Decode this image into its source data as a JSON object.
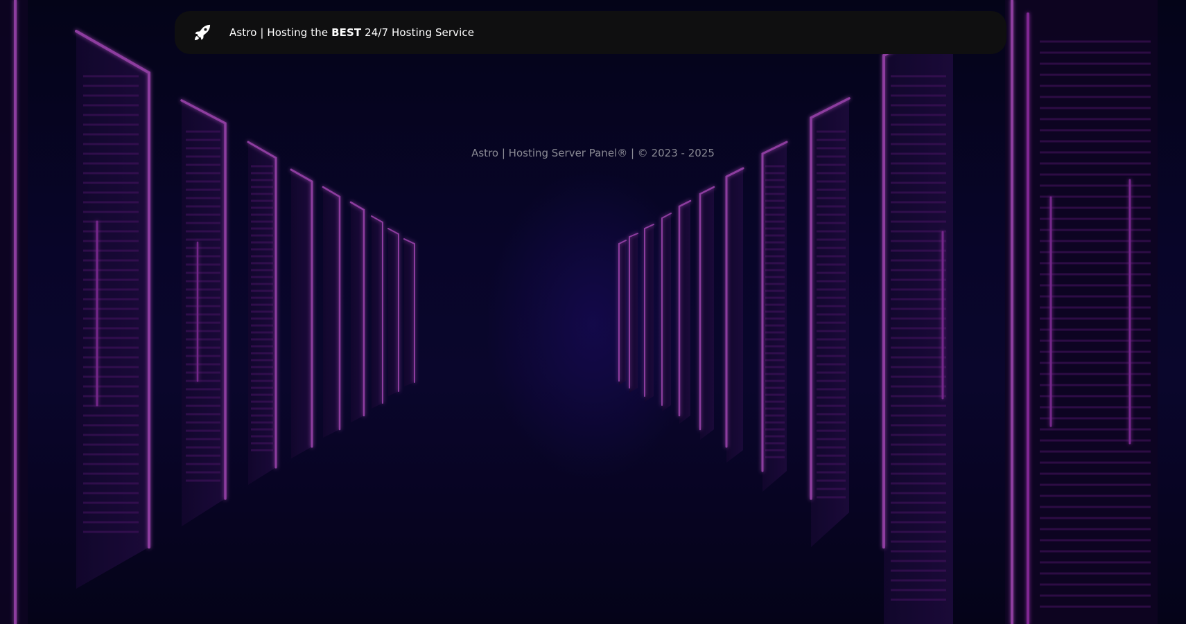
{
  "navbar": {
    "icon": "rocket-icon",
    "brand_prefix": "Astro | Hosting the ",
    "brand_emphasis": "BEST",
    "brand_suffix": " 24/7 Hosting Service"
  },
  "footer": {
    "copyright": "Astro | Hosting Server Panel® | © 2023 - 2025"
  },
  "colors": {
    "navbar_bg": "#0f0f10",
    "neon_accent": "#c23ad6",
    "background": "#0a0733",
    "footer_text": "#8a8a94"
  }
}
